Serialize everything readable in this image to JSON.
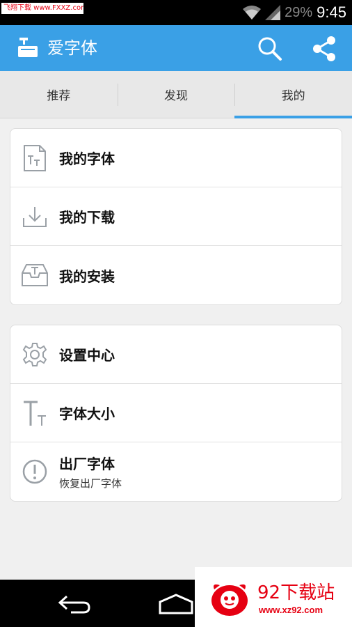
{
  "status_bar": {
    "watermark": "飞翔下载 www.FXXZ.com",
    "battery": "29%",
    "time": "9:45"
  },
  "app_bar": {
    "title": "爱字体",
    "icons": [
      "font-logo-icon",
      "search-icon",
      "share-icon"
    ],
    "color": "#3aa0e6"
  },
  "tabs": [
    {
      "label": "推荐",
      "active": false
    },
    {
      "label": "发现",
      "active": false
    },
    {
      "label": "我的",
      "active": true
    }
  ],
  "card1": {
    "items": [
      {
        "label": "我的字体",
        "icon": "font-file-icon"
      },
      {
        "label": "我的下载",
        "icon": "download-icon"
      },
      {
        "label": "我的安装",
        "icon": "install-tray-icon"
      }
    ]
  },
  "card2": {
    "items": [
      {
        "label": "设置中心",
        "icon": "gear-icon"
      },
      {
        "label": "字体大小",
        "icon": "text-size-icon"
      },
      {
        "label": "出厂字体",
        "sub": "恢复出厂字体",
        "icon": "alert-circle-icon"
      }
    ]
  },
  "nav_bar": {
    "icons": [
      "back-icon",
      "home-icon"
    ]
  },
  "watermark_bottom": {
    "title": "92下载站",
    "url": "www.xz92.com"
  }
}
